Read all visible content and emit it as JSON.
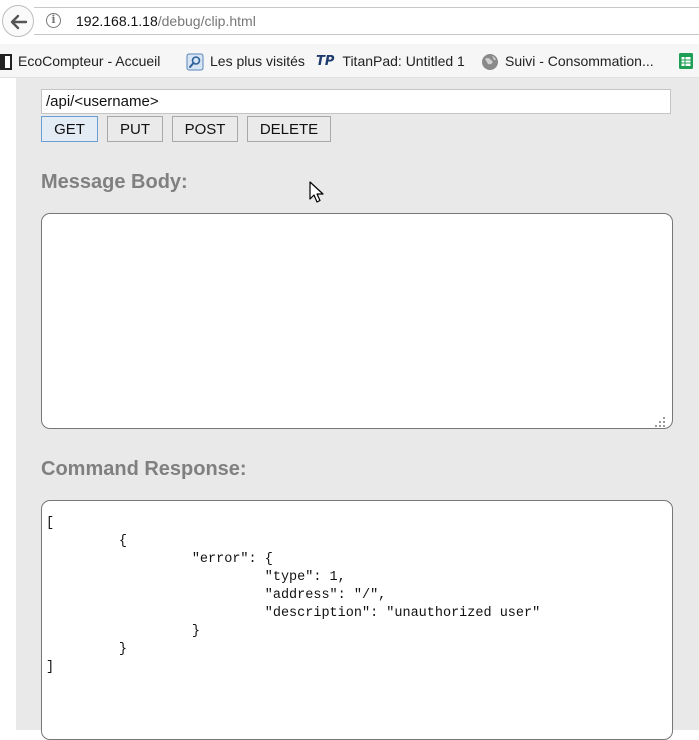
{
  "browser": {
    "url_host": "192.168.1.18",
    "url_path": "/debug/clip.html",
    "bookmarks": [
      {
        "label": "EcoCompteur - Accueil",
        "icon": "document-icon"
      },
      {
        "label": "Les plus visités",
        "icon": "search-icon"
      },
      {
        "label": "TitanPad: Untitled 1",
        "icon": "titanpad-icon",
        "icon_text": "TP"
      },
      {
        "label": "Suivi - Consommation...",
        "icon": "globe-icon"
      }
    ]
  },
  "form": {
    "path_value": "/api/<username>",
    "methods": [
      "GET",
      "PUT",
      "POST",
      "DELETE"
    ],
    "message_body_title": "Message Body:",
    "message_body_value": "",
    "response_title": "Command Response:",
    "response_text": "[\n\t{\n\t\t\"error\": {\n\t\t\t\"type\": 1,\n\t\t\t\"address\": \"/\",\n\t\t\t\"description\": \"unauthorized user\"\n\t\t}\n\t}\n]"
  },
  "colors": {
    "page_background": "#e9e9e9",
    "section_title": "#808080",
    "active_button_border": "#6a9fd4"
  }
}
